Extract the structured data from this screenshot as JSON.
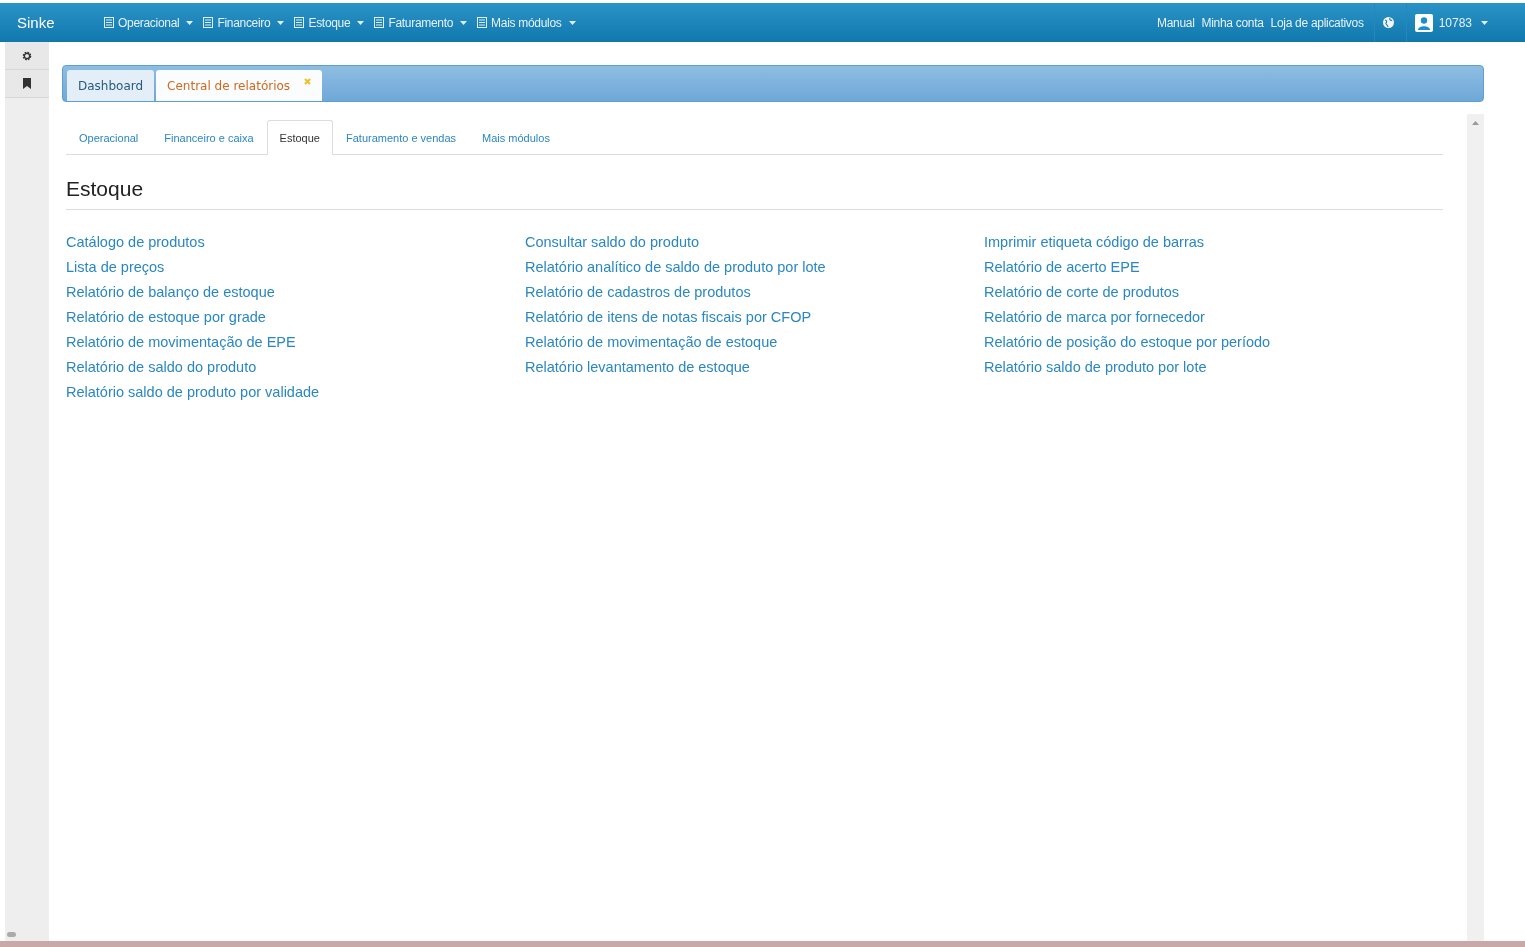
{
  "navbar": {
    "brand": "Sinke",
    "menus": [
      {
        "label": "Operacional"
      },
      {
        "label": "Financeiro"
      },
      {
        "label": "Estoque"
      },
      {
        "label": "Faturamento"
      },
      {
        "label": "Mais módulos"
      }
    ],
    "links": [
      "Manual",
      "Minha conta",
      "Loja de aplicativos"
    ],
    "user": "10783"
  },
  "page_tabs": [
    {
      "label": "Dashboard",
      "selected": false,
      "closable": false
    },
    {
      "label": "Central de relatórios",
      "selected": true,
      "closable": true
    }
  ],
  "section_tabs": [
    {
      "label": "Operacional",
      "selected": false
    },
    {
      "label": "Financeiro e caixa",
      "selected": false
    },
    {
      "label": "Estoque",
      "selected": true
    },
    {
      "label": "Faturamento e vendas",
      "selected": false
    },
    {
      "label": "Mais módulos",
      "selected": false
    }
  ],
  "heading": "Estoque",
  "report_columns": [
    [
      "Catálogo de produtos",
      "Lista de preços",
      "Relatório de balanço de estoque",
      "Relatório de estoque por grade",
      "Relatório de movimentação de EPE",
      "Relatório de saldo do produto",
      "Relatório saldo de produto por validade"
    ],
    [
      "Consultar saldo do produto",
      "Relatório analítico de saldo de produto por lote",
      "Relatório de cadastros de produtos",
      "Relatório de itens de notas fiscais por CFOP",
      "Relatório de movimentação de estoque",
      "Relatório levantamento de estoque"
    ],
    [
      "Imprimir etiqueta código de barras",
      "Relatório de acerto EPE",
      "Relatório de corte de produtos",
      "Relatório de marca por fornecedor",
      "Relatório de posição do estoque por período",
      "Relatório saldo de produto por lote"
    ]
  ]
}
